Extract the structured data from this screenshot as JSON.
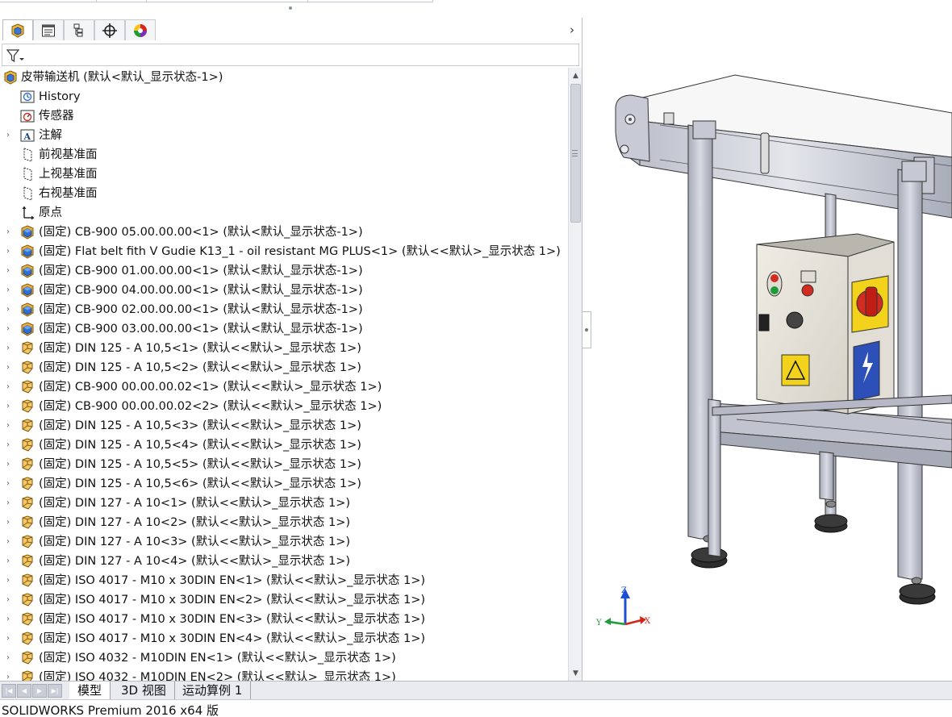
{
  "tabs": [
    {
      "name": "featuremanager"
    },
    {
      "name": "propertymanager"
    },
    {
      "name": "configurationmanager"
    },
    {
      "name": "dimxpertmanager"
    },
    {
      "name": "display-manager"
    }
  ],
  "tree": {
    "root_label": "皮带输送机  (默认<默认_显示状态-1>)",
    "items": [
      {
        "label": "History",
        "icon": "history-icon",
        "expand": false
      },
      {
        "label": "传感器",
        "icon": "sensor-icon",
        "expand": false
      },
      {
        "label": "注解",
        "icon": "annotation-icon",
        "expand": true
      },
      {
        "label": "前视基准面",
        "icon": "plane-icon",
        "expand": false
      },
      {
        "label": "上视基准面",
        "icon": "plane-icon",
        "expand": false
      },
      {
        "label": "右视基准面",
        "icon": "plane-icon",
        "expand": false
      },
      {
        "label": "原点",
        "icon": "origin-icon",
        "expand": false
      },
      {
        "label": "(固定) CB-900 05.00.00.00<1> (默认<默认_显示状态-1>)",
        "icon": "subassembly-icon",
        "expand": true
      },
      {
        "label": "(固定) Flat belt fith V Gudie K13_1 - oil resistant MG PLUS<1> (默认<<默认>_显示状态 1>)",
        "icon": "subassembly-icon",
        "expand": true
      },
      {
        "label": "(固定) CB-900 01.00.00.00<1> (默认<默认_显示状态-1>)",
        "icon": "subassembly-icon",
        "expand": true
      },
      {
        "label": "(固定) CB-900 04.00.00.00<1> (默认<默认_显示状态-1>)",
        "icon": "subassembly-icon",
        "expand": true
      },
      {
        "label": "(固定) CB-900 02.00.00.00<1> (默认<默认_显示状态-1>)",
        "icon": "subassembly-icon",
        "expand": true
      },
      {
        "label": "(固定) CB-900 03.00.00.00<1> (默认<默认_显示状态-1>)",
        "icon": "subassembly-icon",
        "expand": true
      },
      {
        "label": "(固定) DIN 125 - A 10,5<1> (默认<<默认>_显示状态 1>)",
        "icon": "part-icon",
        "expand": true
      },
      {
        "label": "(固定) DIN 125 - A 10,5<2> (默认<<默认>_显示状态 1>)",
        "icon": "part-icon",
        "expand": true
      },
      {
        "label": "(固定) CB-900 00.00.00.02<1> (默认<<默认>_显示状态 1>)",
        "icon": "part-icon",
        "expand": true
      },
      {
        "label": "(固定) CB-900 00.00.00.02<2> (默认<<默认>_显示状态 1>)",
        "icon": "part-icon",
        "expand": true
      },
      {
        "label": "(固定) DIN 125 - A 10,5<3> (默认<<默认>_显示状态 1>)",
        "icon": "part-icon",
        "expand": true
      },
      {
        "label": "(固定) DIN 125 - A 10,5<4> (默认<<默认>_显示状态 1>)",
        "icon": "part-icon",
        "expand": true
      },
      {
        "label": "(固定) DIN 125 - A 10,5<5> (默认<<默认>_显示状态 1>)",
        "icon": "part-icon",
        "expand": true
      },
      {
        "label": "(固定) DIN 125 - A 10,5<6> (默认<<默认>_显示状态 1>)",
        "icon": "part-icon",
        "expand": true
      },
      {
        "label": "(固定) DIN 127 - A 10<1> (默认<<默认>_显示状态 1>)",
        "icon": "part-icon",
        "expand": true
      },
      {
        "label": "(固定) DIN 127 - A 10<2> (默认<<默认>_显示状态 1>)",
        "icon": "part-icon",
        "expand": true
      },
      {
        "label": "(固定) DIN 127 - A 10<3> (默认<<默认>_显示状态 1>)",
        "icon": "part-icon",
        "expand": true
      },
      {
        "label": "(固定) DIN 127 - A 10<4> (默认<<默认>_显示状态 1>)",
        "icon": "part-icon",
        "expand": true
      },
      {
        "label": "(固定) ISO 4017 - M10 x 30DIN EN<1> (默认<<默认>_显示状态 1>)",
        "icon": "part-icon",
        "expand": true
      },
      {
        "label": "(固定) ISO 4017 - M10 x 30DIN EN<2> (默认<<默认>_显示状态 1>)",
        "icon": "part-icon",
        "expand": true
      },
      {
        "label": "(固定) ISO 4017 - M10 x 30DIN EN<3> (默认<<默认>_显示状态 1>)",
        "icon": "part-icon",
        "expand": true
      },
      {
        "label": "(固定) ISO 4017 - M10 x 30DIN EN<4> (默认<<默认>_显示状态 1>)",
        "icon": "part-icon",
        "expand": true
      },
      {
        "label": "(固定) ISO 4032 - M10DIN EN<1> (默认<<默认>_显示状态 1>)",
        "icon": "part-icon",
        "expand": true
      },
      {
        "label": "(固定) ISO 4032 - M10DIN EN<2> (默认<<默认>_显示状态 1>)",
        "icon": "part-icon",
        "expand": true
      }
    ]
  },
  "bottom_tabs": [
    "模型",
    "3D 视图",
    "运动算例 1"
  ],
  "active_bottom_tab": 0,
  "status": "SOLIDWORKS Premium 2016 x64 版",
  "triad": {
    "x": "X",
    "y": "Y",
    "z": "Z"
  },
  "colors": {
    "subassembly_blue": "#2f6fd0",
    "part_yellow": "#f0b43a",
    "box_red": "#d22b1f",
    "box_yellow": "#f2d21a",
    "box_blue": "#2c4fb8",
    "frame_gray": "#c9ccd6"
  }
}
